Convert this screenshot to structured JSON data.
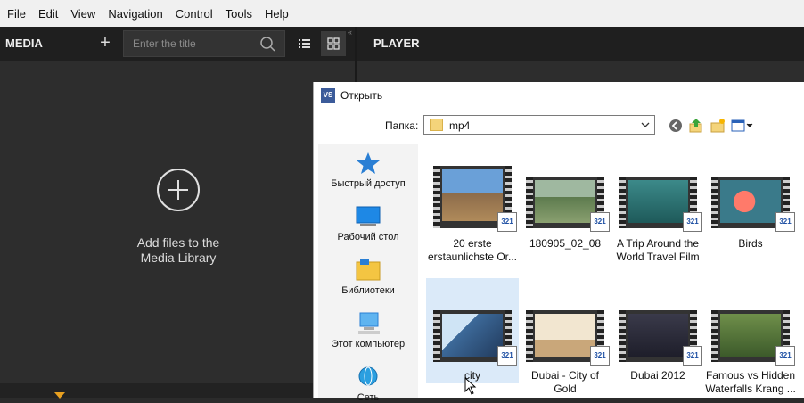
{
  "menu": [
    "File",
    "Edit",
    "View",
    "Navigation",
    "Control",
    "Tools",
    "Help"
  ],
  "media": {
    "title": "MEDIA",
    "add_label": "+",
    "search_placeholder": "Enter the title",
    "empty_text_line1": "Add files to the",
    "empty_text_line2": "Media Library"
  },
  "player": {
    "title": "PLAYER"
  },
  "dialog": {
    "app_icon": "VS",
    "title": "Открыть",
    "folder_label": "Папка:",
    "folder_value": "mp4",
    "places": [
      {
        "label": "Быстрый доступ",
        "icon": "star-icon"
      },
      {
        "label": "Рабочий стол",
        "icon": "desktop-icon"
      },
      {
        "label": "Библиотеки",
        "icon": "library-icon"
      },
      {
        "label": "Этот компьютер",
        "icon": "computer-icon"
      },
      {
        "label": "Сеть",
        "icon": "network-icon"
      }
    ],
    "files": [
      {
        "line1": "20 erste",
        "line2": "erstaunlichste Or..."
      },
      {
        "line1": "180905_02_08",
        "line2": ""
      },
      {
        "line1": "A Trip Around the",
        "line2": "World Travel Film"
      },
      {
        "line1": "Birds",
        "line2": ""
      },
      {
        "line1": "city",
        "line2": ""
      },
      {
        "line1": "Dubai - City of",
        "line2": "Gold"
      },
      {
        "line1": "Dubai 2012",
        "line2": ""
      },
      {
        "line1": "Famous vs Hidden",
        "line2": "Waterfalls Krang ..."
      }
    ],
    "badge_text": "321"
  }
}
